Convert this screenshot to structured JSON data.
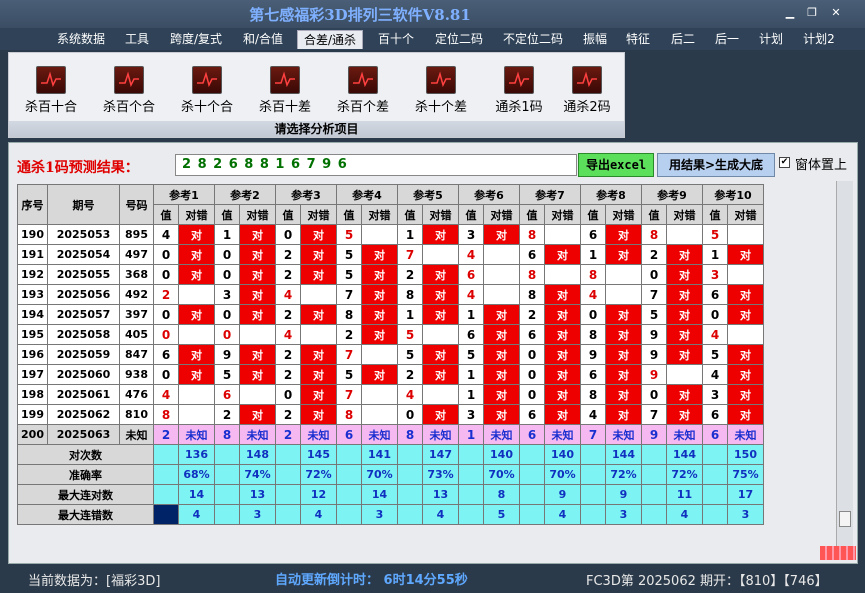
{
  "window": {
    "title": "第七感福彩3D排列三软件V8.81",
    "minimize": "▁",
    "maximize": "❐",
    "close": "✕"
  },
  "menu": [
    "系统数据",
    "工具",
    "跨度/复式",
    "和/合值",
    "合差/通杀",
    "百十个",
    "定位二码",
    "不定位二码",
    "振幅",
    "特征",
    "后二",
    "后一",
    "计划",
    "计划2"
  ],
  "menu_active": "合差/通杀",
  "ribbon": {
    "buttons": [
      {
        "label": "杀百十合",
        "icon": "chart-icon"
      },
      {
        "label": "杀百个合",
        "icon": "chart-icon"
      },
      {
        "label": "杀十个合",
        "icon": "chart-icon"
      },
      {
        "label": "杀百十差",
        "icon": "chart-icon"
      },
      {
        "label": "杀百个差",
        "icon": "chart-icon"
      },
      {
        "label": "杀十个差",
        "icon": "chart-icon"
      },
      {
        "label": "通杀1码",
        "icon": "chart-icon"
      },
      {
        "label": "通杀2码",
        "icon": "chart-icon"
      }
    ],
    "footer": "请选择分析项目"
  },
  "prediction": {
    "label": "通杀1码预测结果：",
    "value": "2 8 2 6 8 8 1 6 7 9 6",
    "export_button": "导出excel",
    "generate_button": "用结果>生成大底",
    "checkbox_checked": "✔",
    "checkbox_label": "窗体置上"
  },
  "table": {
    "h_seq": "序号",
    "h_qi": "期号",
    "h_num": "号码",
    "h_val": "值",
    "h_cd": "对错",
    "ref_headers": [
      "参考1",
      "参考2",
      "参考3",
      "参考4",
      "参考5",
      "参考6",
      "参考7",
      "参考8",
      "参考9",
      "参考10"
    ],
    "hit_text": "对",
    "rows": [
      {
        "seq": "190",
        "qi": "2025053",
        "num": "895",
        "cells": [
          [
            "4",
            "对"
          ],
          [
            "1",
            "对"
          ],
          [
            "0",
            "对"
          ],
          [
            "5",
            ""
          ],
          [
            "1",
            "对"
          ],
          [
            "3",
            "对"
          ],
          [
            "8",
            ""
          ],
          [
            "6",
            "对"
          ],
          [
            "8",
            ""
          ],
          [
            "5",
            ""
          ]
        ]
      },
      {
        "seq": "191",
        "qi": "2025054",
        "num": "497",
        "cells": [
          [
            "0",
            "对"
          ],
          [
            "0",
            "对"
          ],
          [
            "2",
            "对"
          ],
          [
            "5",
            "对"
          ],
          [
            "7",
            ""
          ],
          [
            "4",
            ""
          ],
          [
            "6",
            "对"
          ],
          [
            "1",
            "对"
          ],
          [
            "2",
            "对"
          ],
          [
            "1",
            "对"
          ]
        ]
      },
      {
        "seq": "192",
        "qi": "2025055",
        "num": "368",
        "cells": [
          [
            "0",
            "对"
          ],
          [
            "0",
            "对"
          ],
          [
            "2",
            "对"
          ],
          [
            "5",
            "对"
          ],
          [
            "2",
            "对"
          ],
          [
            "6",
            ""
          ],
          [
            "8",
            ""
          ],
          [
            "8",
            ""
          ],
          [
            "0",
            "对"
          ],
          [
            "3",
            ""
          ]
        ]
      },
      {
        "seq": "193",
        "qi": "2025056",
        "num": "492",
        "cells": [
          [
            "2",
            ""
          ],
          [
            "3",
            "对"
          ],
          [
            "4",
            ""
          ],
          [
            "7",
            "对"
          ],
          [
            "8",
            "对"
          ],
          [
            "4",
            ""
          ],
          [
            "8",
            "对"
          ],
          [
            "4",
            ""
          ],
          [
            "7",
            "对"
          ],
          [
            "6",
            "对"
          ]
        ]
      },
      {
        "seq": "194",
        "qi": "2025057",
        "num": "397",
        "cells": [
          [
            "0",
            "对"
          ],
          [
            "0",
            "对"
          ],
          [
            "2",
            "对"
          ],
          [
            "8",
            "对"
          ],
          [
            "1",
            "对"
          ],
          [
            "1",
            "对"
          ],
          [
            "2",
            "对"
          ],
          [
            "0",
            "对"
          ],
          [
            "5",
            "对"
          ],
          [
            "0",
            "对"
          ]
        ]
      },
      {
        "seq": "195",
        "qi": "2025058",
        "num": "405",
        "cells": [
          [
            "0",
            ""
          ],
          [
            "0",
            ""
          ],
          [
            "4",
            ""
          ],
          [
            "2",
            "对"
          ],
          [
            "5",
            ""
          ],
          [
            "6",
            "对"
          ],
          [
            "6",
            "对"
          ],
          [
            "8",
            "对"
          ],
          [
            "9",
            "对"
          ],
          [
            "4",
            ""
          ]
        ]
      },
      {
        "seq": "196",
        "qi": "2025059",
        "num": "847",
        "cells": [
          [
            "6",
            "对"
          ],
          [
            "9",
            "对"
          ],
          [
            "2",
            "对"
          ],
          [
            "7",
            ""
          ],
          [
            "5",
            "对"
          ],
          [
            "5",
            "对"
          ],
          [
            "0",
            "对"
          ],
          [
            "9",
            "对"
          ],
          [
            "9",
            "对"
          ],
          [
            "5",
            "对"
          ]
        ]
      },
      {
        "seq": "197",
        "qi": "2025060",
        "num": "938",
        "cells": [
          [
            "0",
            "对"
          ],
          [
            "5",
            "对"
          ],
          [
            "2",
            "对"
          ],
          [
            "5",
            "对"
          ],
          [
            "2",
            "对"
          ],
          [
            "1",
            "对"
          ],
          [
            "0",
            "对"
          ],
          [
            "6",
            "对"
          ],
          [
            "9",
            ""
          ],
          [
            "4",
            "对"
          ]
        ]
      },
      {
        "seq": "198",
        "qi": "2025061",
        "num": "476",
        "cells": [
          [
            "4",
            ""
          ],
          [
            "6",
            ""
          ],
          [
            "0",
            "对"
          ],
          [
            "7",
            ""
          ],
          [
            "4",
            ""
          ],
          [
            "1",
            "对"
          ],
          [
            "0",
            "对"
          ],
          [
            "8",
            "对"
          ],
          [
            "0",
            "对"
          ],
          [
            "3",
            "对"
          ]
        ]
      },
      {
        "seq": "199",
        "qi": "2025062",
        "num": "810",
        "cells": [
          [
            "8",
            ""
          ],
          [
            "2",
            "对"
          ],
          [
            "2",
            "对"
          ],
          [
            "8",
            ""
          ],
          [
            "0",
            "对"
          ],
          [
            "3",
            "对"
          ],
          [
            "6",
            "对"
          ],
          [
            "4",
            "对"
          ],
          [
            "7",
            "对"
          ],
          [
            "6",
            "对"
          ]
        ]
      }
    ],
    "unknown_row": {
      "seq": "200",
      "qi": "2025063",
      "num": "未知",
      "vals": [
        "2",
        "8",
        "2",
        "6",
        "8",
        "1",
        "6",
        "7",
        "9",
        "6"
      ],
      "cd": "未知"
    },
    "stats": [
      {
        "label": "对次数",
        "values": [
          "136",
          "148",
          "145",
          "141",
          "147",
          "140",
          "140",
          "144",
          "144",
          "150"
        ]
      },
      {
        "label": "准确率",
        "values": [
          "68%",
          "74%",
          "72%",
          "70%",
          "73%",
          "70%",
          "70%",
          "72%",
          "72%",
          "75%"
        ]
      },
      {
        "label": "最大连对数",
        "values": [
          "14",
          "13",
          "12",
          "14",
          "13",
          "8",
          "9",
          "9",
          "11",
          "17"
        ]
      },
      {
        "label": "最大连错数",
        "values": [
          "4",
          "3",
          "4",
          "3",
          "4",
          "5",
          "4",
          "3",
          "4",
          "3"
        ]
      }
    ]
  },
  "status": {
    "current": "当前数据为：[福彩3D]",
    "countdown": "自动更新倒计时： 6时14分55秒",
    "info": "FC3D第 2025062 期开：【810】【746】"
  },
  "colors": {
    "hit": "#ee0000",
    "stat_bg": "#7df3f3",
    "unknown_bg": "#f6b8f0",
    "title": "#7fb0ff"
  }
}
